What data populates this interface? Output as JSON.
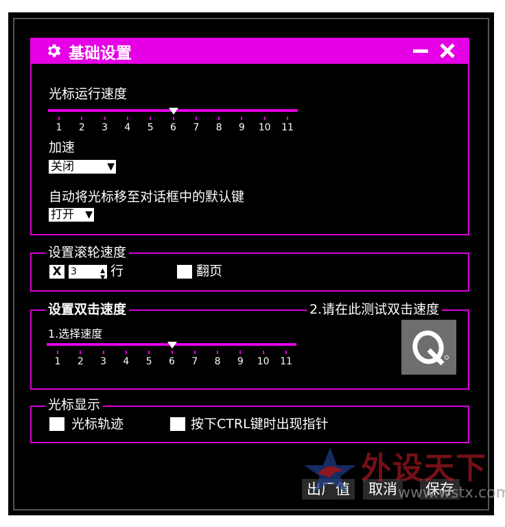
{
  "window": {
    "title": "基础设置",
    "accent_color": "#e600e6",
    "icons": {
      "settings": "gear-icon",
      "minimize": "minimize-icon",
      "close": "close-icon"
    }
  },
  "pointer_speed": {
    "label": "光标运行速度",
    "ticks": [
      "1",
      "2",
      "3",
      "4",
      "5",
      "6",
      "7",
      "8",
      "9",
      "10",
      "11"
    ],
    "value": 6
  },
  "acceleration": {
    "label": "加速",
    "selected": "关闭"
  },
  "snap_to": {
    "label": "自动将光标移至对话框中的默认键",
    "selected": "打开"
  },
  "wheel": {
    "legend": "设置滚轮速度",
    "checkbox_mark": "X",
    "lines_value": "3",
    "lines_label": "行",
    "page_label": "翻页"
  },
  "double_click": {
    "legend": "设置双击速度",
    "test_legend": "2.请在此测试双击速度",
    "select_label": "1.选择速度",
    "ticks": [
      "1",
      "2",
      "3",
      "4",
      "5",
      "6",
      "7",
      "8",
      "9",
      "10",
      "11"
    ],
    "value": 6
  },
  "pointer_display": {
    "legend": "光标显示",
    "trails_label": "光标轨迹",
    "ctrl_label": "按下CTRL键时出现指针"
  },
  "buttons": {
    "defaults": "出厂值",
    "cancel": "取消",
    "save": "保存"
  },
  "watermark": {
    "text": "外设天下",
    "url": "www.wstx.com"
  }
}
